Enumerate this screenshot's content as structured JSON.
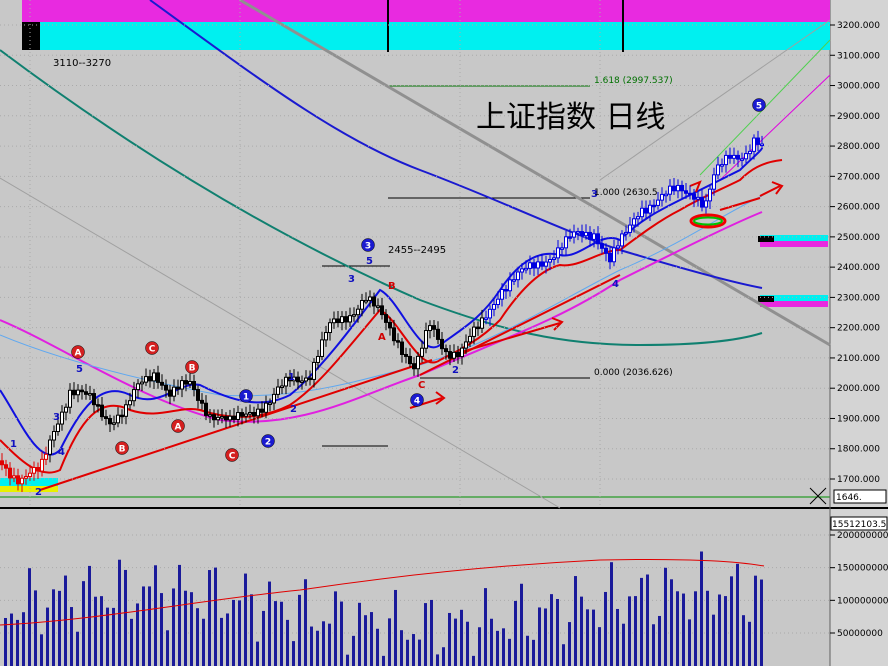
{
  "chart_data": {
    "type": "candlestick",
    "title": "上证指数  日线",
    "price_axis": {
      "ticks": [
        "3200.000",
        "3100.000",
        "3000.000",
        "2900.000",
        "2800.000",
        "2700.000",
        "2600.000",
        "2500.000",
        "2400.000",
        "2300.000",
        "2200.000",
        "2100.000",
        "2000.000",
        "1900.000",
        "1800.000",
        "1700.000"
      ],
      "tick_values": [
        3200,
        3100,
        3000,
        2900,
        2800,
        2700,
        2600,
        2500,
        2400,
        2300,
        2200,
        2100,
        2000,
        1900,
        1800,
        1700
      ],
      "ylim": [
        1640,
        3240
      ],
      "current_price_label": "1646.",
      "last_value_label": "15512103.5"
    },
    "volume_axis": {
      "ticks": [
        "200000000",
        "150000000",
        "100000000",
        "50000000"
      ],
      "tick_values": [
        200000000,
        150000000,
        100000000,
        50000000
      ]
    },
    "annotations": {
      "range_top": "3110--3270",
      "range_mid": "2455--2495",
      "fib_1618": "1.618 (2997.537)",
      "fib_1000": "1.000 (2630.5",
      "fib_0000": "0.000 (2036.626)"
    },
    "wave_labels": [
      {
        "text": "A",
        "color": "#d00000"
      },
      {
        "text": "B",
        "color": "#d00000"
      },
      {
        "text": "C",
        "color": "#d00000"
      },
      {
        "text": "1",
        "color": "#1010c0"
      },
      {
        "text": "2",
        "color": "#1010c0"
      },
      {
        "text": "3",
        "color": "#1010c0"
      },
      {
        "text": "4",
        "color": "#1010c0"
      },
      {
        "text": "5",
        "color": "#1010c0"
      }
    ],
    "series": [
      {
        "name": "price",
        "color": "#000000"
      },
      {
        "name": "ma_fast",
        "color": "#d00000"
      },
      {
        "name": "ma_mid",
        "color": "#0000d0"
      },
      {
        "name": "ma_slow",
        "color": "#0000a0"
      },
      {
        "name": "ma_long",
        "color": "#108070"
      },
      {
        "name": "ma_magenta",
        "color": "#e000e0"
      }
    ],
    "colors": {
      "magenta_band": "#e82ae0",
      "cyan_band": "#00f0f0",
      "accent_red": "#e00000"
    }
  }
}
